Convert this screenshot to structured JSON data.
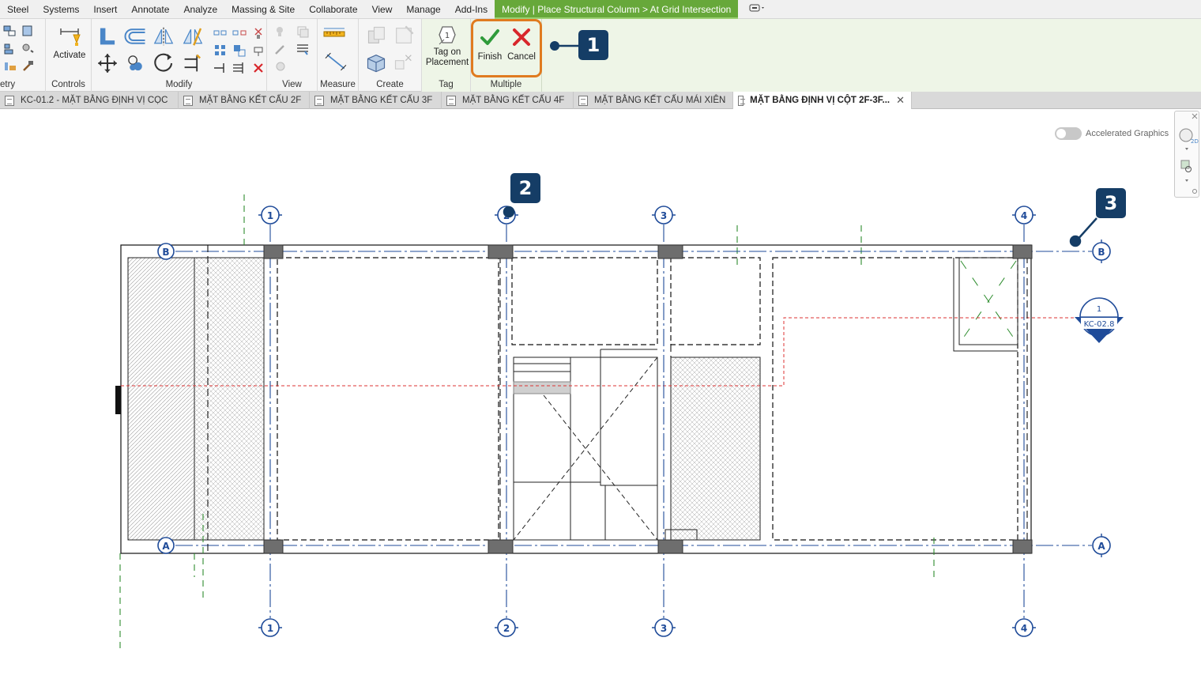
{
  "menu": {
    "items": [
      "Steel",
      "Systems",
      "Insert",
      "Annotate",
      "Analyze",
      "Massing & Site",
      "Collaborate",
      "View",
      "Manage",
      "Add-Ins"
    ],
    "context_tab": "Modify | Place Structural Column > At Grid Intersection"
  },
  "ribbon": {
    "panels": {
      "geometry": "etry",
      "controls": "Controls",
      "modify": "Modify",
      "view": "View",
      "measure": "Measure",
      "create": "Create",
      "tag": "Tag",
      "multiple": "Multiple"
    },
    "activate_label": "Activate",
    "tag_on_placement_line1": "Tag on",
    "tag_on_placement_line2": "Placement",
    "finish_label": "Finish",
    "cancel_label": "Cancel"
  },
  "callouts": {
    "one": "1",
    "two": "2",
    "three": "3"
  },
  "tabs": [
    {
      "label": "KC-01.2 - MẶT BẰNG ĐỊNH VỊ CỌC"
    },
    {
      "label": "MẶT BẰNG KẾT CẤU 2F"
    },
    {
      "label": "MẶT BẰNG KẾT CẤU 3F"
    },
    {
      "label": "MẶT BẰNG KẾT CẤU 4F"
    },
    {
      "label": "MẶT BẰNG KẾT CẤU MÁI XIÊN"
    },
    {
      "label": "MẶT BẰNG ĐỊNH VỊ CỘT 2F-3F..."
    }
  ],
  "tab_close": "✕",
  "canvas": {
    "accelerated_graphics": "Accelerated Graphics",
    "grids_vertical": [
      "1",
      "2",
      "3",
      "4"
    ],
    "grids_horizontal": [
      "B",
      "A"
    ],
    "section_tag_number": "1",
    "section_tag_sheet": "KC-02.8"
  },
  "colors": {
    "context_tab": "#67a83a",
    "highlight": "#e07b20",
    "callout": "#153d66",
    "grid_line": "#1f4b99",
    "finish_check": "#2f9b3a",
    "cancel_x": "#d8262b"
  }
}
